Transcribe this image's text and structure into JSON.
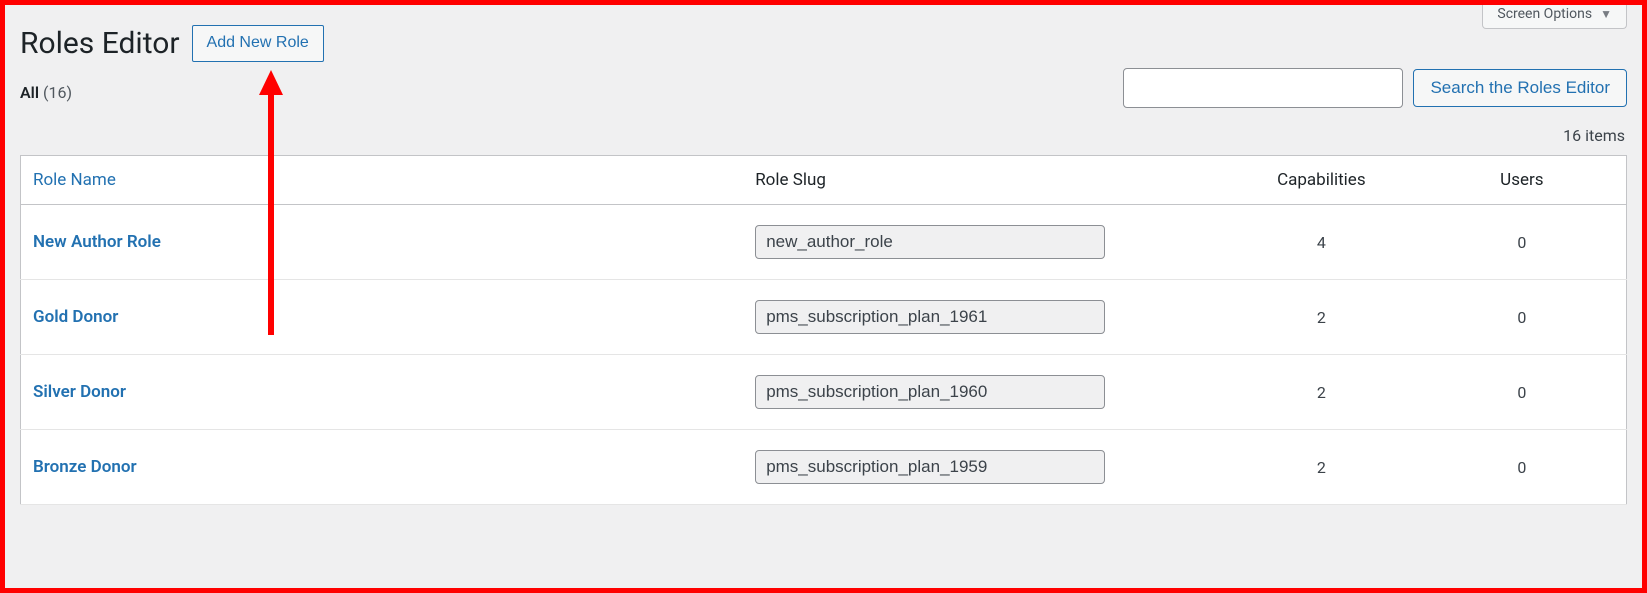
{
  "screen_options_label": "Screen Options",
  "page_title": "Roles Editor",
  "add_new_label": "Add New Role",
  "filter": {
    "all_label": "All",
    "all_count": "(16)"
  },
  "search": {
    "button_label": "Search the Roles Editor",
    "value": ""
  },
  "items_count_label": "16 items",
  "columns": {
    "role_name": "Role Name",
    "role_slug": "Role Slug",
    "capabilities": "Capabilities",
    "users": "Users"
  },
  "rows": [
    {
      "name": "New Author Role",
      "slug": "new_author_role",
      "capabilities": "4",
      "users": "0"
    },
    {
      "name": "Gold Donor",
      "slug": "pms_subscription_plan_1961",
      "capabilities": "2",
      "users": "0"
    },
    {
      "name": "Silver Donor",
      "slug": "pms_subscription_plan_1960",
      "capabilities": "2",
      "users": "0"
    },
    {
      "name": "Bronze Donor",
      "slug": "pms_subscription_plan_1959",
      "capabilities": "2",
      "users": "0"
    }
  ]
}
